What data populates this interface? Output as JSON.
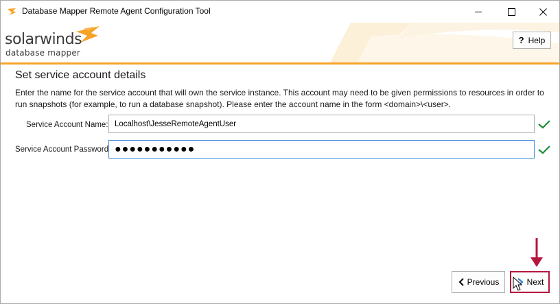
{
  "window": {
    "title": "Database Mapper Remote Agent Configuration Tool"
  },
  "header": {
    "logo_main": "solarwinds",
    "logo_sub": "database mapper",
    "help_label": "Help",
    "help_glyph": "?"
  },
  "page": {
    "title": "Set service account details",
    "description": "Enter the name for the service account that will own the service instance. This account may need to be given permissions to resources in order to run snapshots (for example, to run a database snapshot). Please enter the account name in the form <domain>\\<user>."
  },
  "form": {
    "account_name_label": "Service Account Name:",
    "account_name_value": "Localhost\\JesseRemoteAgentUser",
    "account_password_label": "Service Account Password:",
    "account_password_value": "●●●●●●●●●●●"
  },
  "footer": {
    "previous_label": "Previous",
    "next_label": "Next"
  },
  "colors": {
    "accent": "#f6a327",
    "valid_check": "#1e8c3a",
    "highlight": "#b5163d",
    "focus_border": "#3c8ae0"
  },
  "icons": {
    "app": "solarwinds-flame-icon",
    "check": "checkmark-icon",
    "previous": "chevron-left-icon",
    "next": "chevron-right-icon",
    "annotation": "arrow-down-icon"
  }
}
